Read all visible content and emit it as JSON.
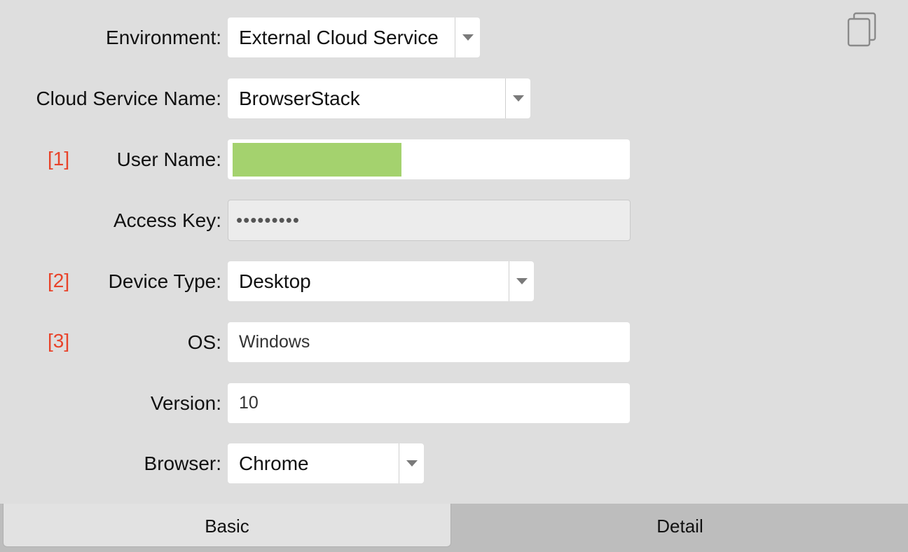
{
  "form": {
    "environment": {
      "label": "Environment:",
      "value": "External Cloud Service"
    },
    "cloud_service_name": {
      "label": "Cloud Service Name:",
      "value": "BrowserStack"
    },
    "user_name": {
      "marker": "[1]",
      "label": "User Name:",
      "value": ""
    },
    "access_key": {
      "label": "Access Key:",
      "value": "•••••••••"
    },
    "device_type": {
      "marker": "[2]",
      "label": "Device Type:",
      "value": "Desktop"
    },
    "os": {
      "marker": "[3]",
      "label": "OS:",
      "value": "Windows"
    },
    "version": {
      "label": "Version:",
      "value": "10"
    },
    "browser": {
      "label": "Browser:",
      "value": "Chrome"
    }
  },
  "toolbar": {
    "copy_icon": "copy-icon"
  },
  "tabs": [
    {
      "label": "Basic",
      "active": true
    },
    {
      "label": "Detail",
      "active": false
    }
  ],
  "colors": {
    "background": "#dedede",
    "marker": "#e8432a",
    "redaction": "#a4d26e",
    "tabbar": "#bdbdbd"
  }
}
